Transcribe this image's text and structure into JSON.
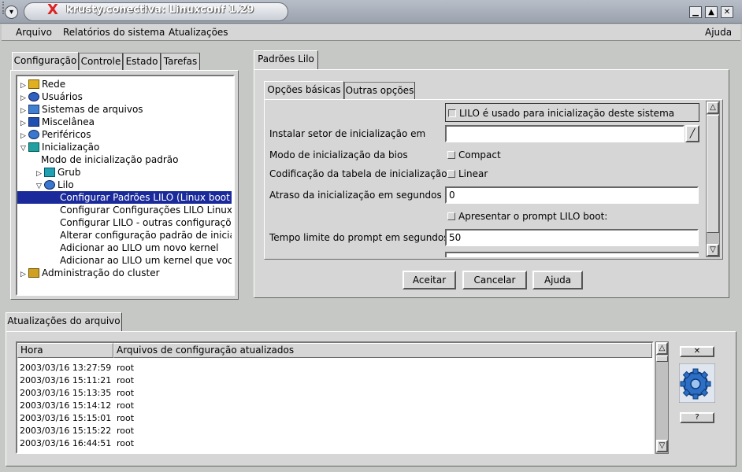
{
  "window": {
    "title": "krusty.conectiva: Linuxconf 1.29",
    "close_glyph": "X",
    "menu_glyph": "▾",
    "minimize_glyph": "▁",
    "maximize_glyph": "▲",
    "close_btn_glyph": "✕"
  },
  "menubar": {
    "items": [
      "Arquivo",
      "Relatórios do sistema",
      "Atualizações"
    ],
    "help": "Ajuda"
  },
  "left_tabs": [
    "Configuração",
    "Controle",
    "Estado",
    "Tarefas"
  ],
  "tree": [
    {
      "label": "Rede",
      "indent": 0,
      "expander": "▷",
      "icon": "network-icon"
    },
    {
      "label": "Usuários",
      "indent": 0,
      "expander": "▷",
      "icon": "users-icon"
    },
    {
      "label": "Sistemas de arquivos",
      "indent": 0,
      "expander": "▷",
      "icon": "filesystem-icon"
    },
    {
      "label": "Miscelânea",
      "indent": 0,
      "expander": "▷",
      "icon": "monitor-icon"
    },
    {
      "label": "Periféricos",
      "indent": 0,
      "expander": "▷",
      "icon": "peripherals-icon"
    },
    {
      "label": "Inicialização",
      "indent": 0,
      "expander": "▽",
      "icon": "boot-icon"
    },
    {
      "label": "Modo de inicialização padrão",
      "indent": 1,
      "expander": "",
      "icon": ""
    },
    {
      "label": "Grub",
      "indent": 1,
      "expander": "▷",
      "icon": "grub-icon"
    },
    {
      "label": "Lilo",
      "indent": 1,
      "expander": "▽",
      "icon": "lilo-icon"
    },
    {
      "label": "Configurar Padrões LILO (Linux boot l",
      "indent": 2,
      "expander": "",
      "icon": "",
      "selected": true
    },
    {
      "label": "Configurar Configurações LILO Linux",
      "indent": 2,
      "expander": "",
      "icon": ""
    },
    {
      "label": "Configurar LILO - outras configuraçõe",
      "indent": 2,
      "expander": "",
      "icon": ""
    },
    {
      "label": "Alterar configuração padrão de inicial",
      "indent": 2,
      "expander": "",
      "icon": ""
    },
    {
      "label": "Adicionar ao LILO um novo kernel",
      "indent": 2,
      "expander": "",
      "icon": ""
    },
    {
      "label": "Adicionar ao LILO um kernel que voc",
      "indent": 2,
      "expander": "",
      "icon": ""
    },
    {
      "label": "Administração do cluster",
      "indent": 0,
      "expander": "▷",
      "icon": "cluster-icon"
    }
  ],
  "right_tab": "Padrões Lilo",
  "inner_tabs": [
    "Opções básicas",
    "Outras opções"
  ],
  "form": {
    "lilo_used_label": "LILO é usado para inicialização deste sistema",
    "boot_sector_label": "Instalar setor de inicialização em",
    "boot_sector_value": "",
    "bios_mode_label": "Modo de inicialização da bios",
    "bios_mode_option": "Compact",
    "table_encoding_label": "Codificação da tabela de inicialização",
    "table_encoding_option": "Linear",
    "delay_label": "Atraso da inicialização em segundos",
    "delay_value": "0",
    "prompt_option": "Apresentar o prompt LILO boot:",
    "timeout_label": "Tempo limite do prompt em segundos",
    "timeout_value": "50",
    "dropdown_glyph": "╱"
  },
  "buttons": {
    "accept": "Aceitar",
    "cancel": "Cancelar",
    "help": "Ajuda"
  },
  "log": {
    "tab": "Atualizações do arquivo",
    "columns": [
      "Hora",
      "Arquivos de configuração atualizados"
    ],
    "rows": [
      [
        "2003/03/16 13:27:59",
        "root"
      ],
      [
        "2003/03/16 15:11:21",
        "root"
      ],
      [
        "2003/03/16 15:13:35",
        "root"
      ],
      [
        "2003/03/16 15:14:12",
        "root"
      ],
      [
        "2003/03/16 15:15:01",
        "root"
      ],
      [
        "2003/03/16 15:15:22",
        "root"
      ],
      [
        "2003/03/16 16:44:51",
        "root"
      ]
    ],
    "close_glyph": "✕",
    "help_glyph": "?"
  },
  "scroll": {
    "up": "△",
    "down": "▽"
  }
}
